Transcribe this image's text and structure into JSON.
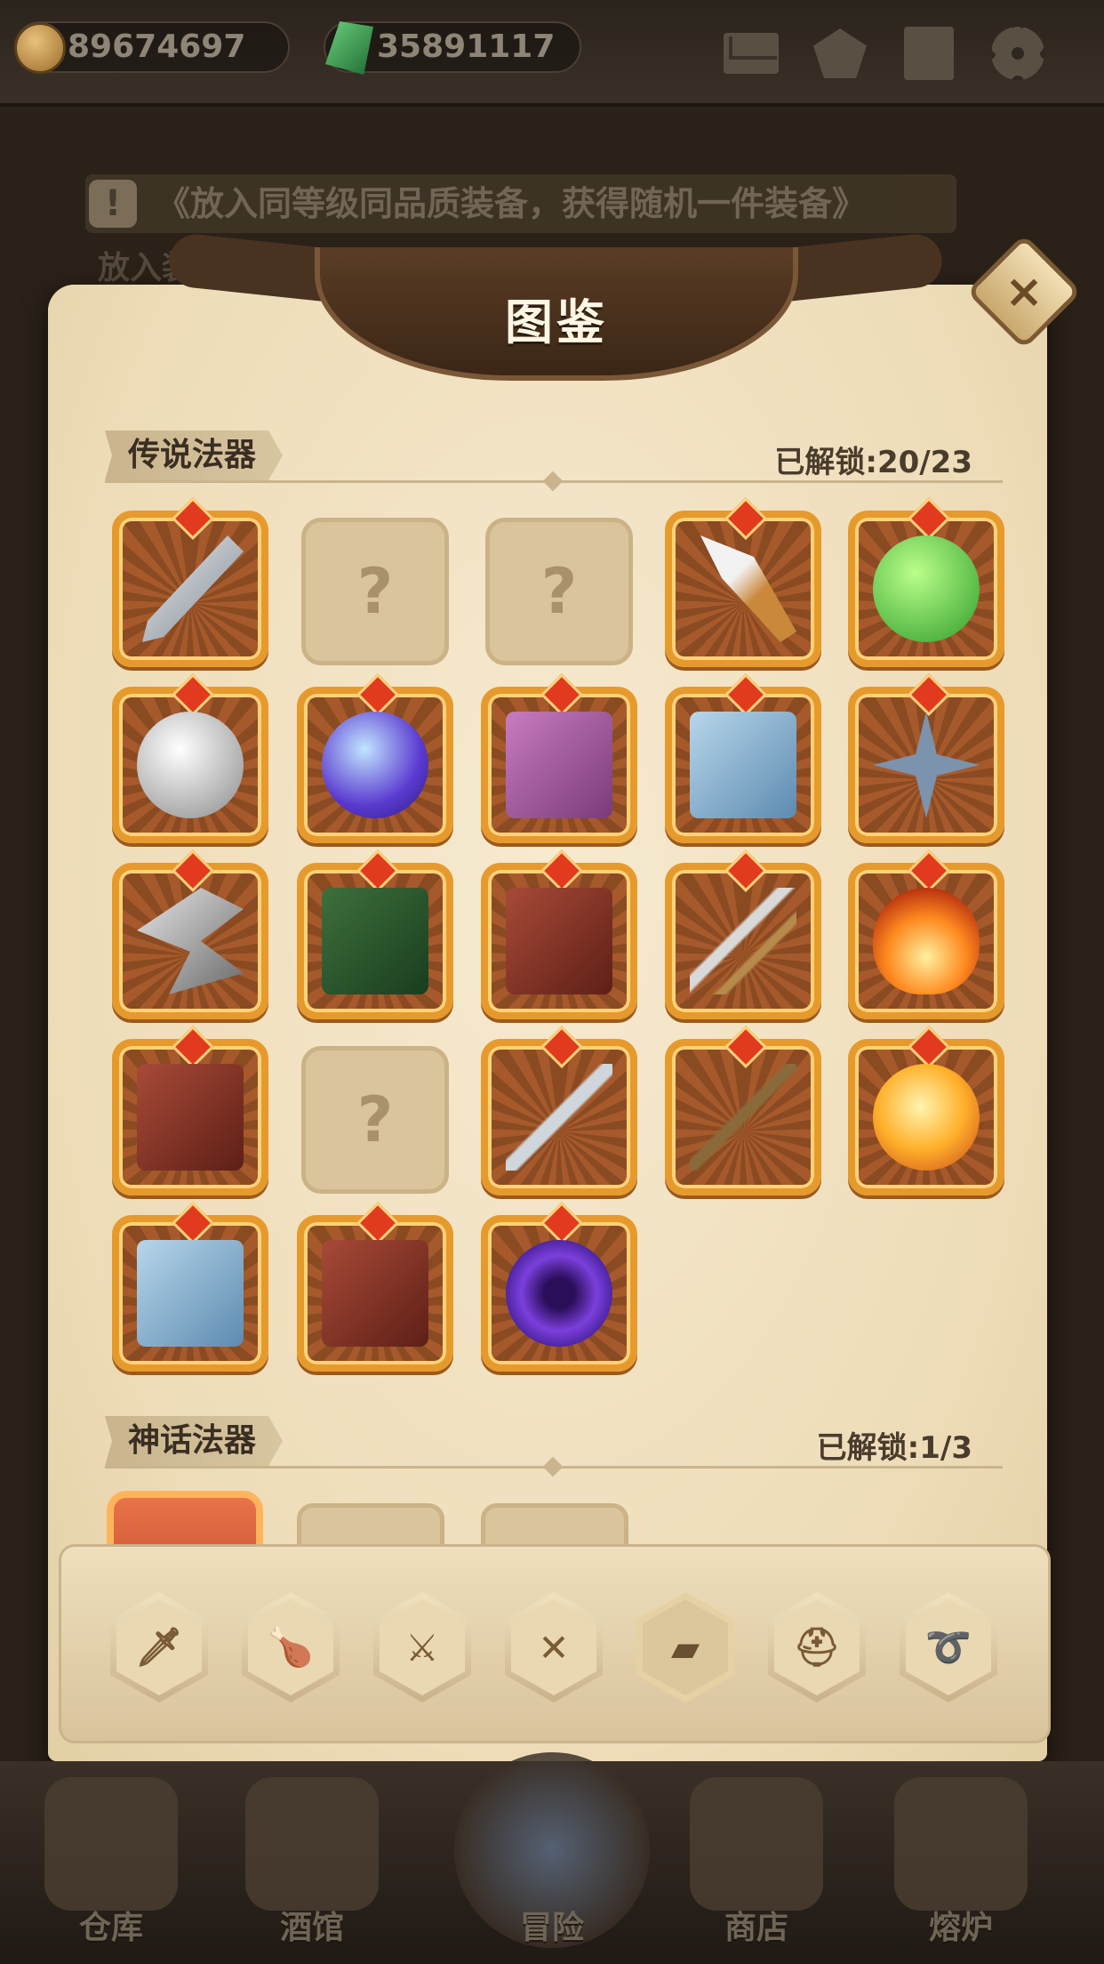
{
  "topbar": {
    "gold": "89674697",
    "gems": "35891117",
    "icons": [
      "coin-icon",
      "gem-icon",
      "mail-icon",
      "star-badge-icon",
      "book-icon",
      "gear-icon"
    ]
  },
  "background": {
    "hint": "《放入同等级同品质装备，获得随机一件装备》",
    "label": "放入装备"
  },
  "dialog": {
    "title": "图鉴",
    "close": "×"
  },
  "legendary": {
    "title": "传说法器",
    "count": "已解锁:20/23",
    "items": [
      {
        "art": "kunai",
        "cls": "blade",
        "locked": false
      },
      {
        "art": "unknown",
        "locked": true
      },
      {
        "art": "unknown",
        "locked": true
      },
      {
        "art": "knife",
        "cls": "knife",
        "locked": false
      },
      {
        "art": "green-slime",
        "cls": "slime",
        "locked": false
      },
      {
        "art": "silver-orb",
        "cls": "silverorb",
        "locked": false
      },
      {
        "art": "purple-planet",
        "cls": "planet",
        "locked": false
      },
      {
        "art": "pink-book",
        "cls": "pinkbook",
        "locked": false
      },
      {
        "art": "blue-book",
        "cls": "bluebook",
        "locked": false
      },
      {
        "art": "shuriken",
        "cls": "shuriken",
        "locked": false
      },
      {
        "art": "hook-blade",
        "cls": "hook",
        "locked": false
      },
      {
        "art": "green-book",
        "cls": "greenbook",
        "locked": false
      },
      {
        "art": "red-book",
        "cls": "redbook",
        "locked": false
      },
      {
        "art": "arrows",
        "cls": "arrows",
        "locked": false
      },
      {
        "art": "fireball",
        "cls": "fire",
        "locked": false
      },
      {
        "art": "red-book",
        "cls": "redbook",
        "locked": false
      },
      {
        "art": "unknown",
        "locked": true
      },
      {
        "art": "dagger",
        "cls": "dagger",
        "locked": false
      },
      {
        "art": "spears",
        "cls": "spear",
        "locked": false
      },
      {
        "art": "sun-orb",
        "cls": "sunorb",
        "locked": false
      },
      {
        "art": "blue-book",
        "cls": "bluebook",
        "locked": false
      },
      {
        "art": "red-book",
        "cls": "redbook",
        "locked": false
      },
      {
        "art": "void-orb",
        "cls": "voidorb",
        "locked": false
      }
    ],
    "locked_mark": "?"
  },
  "mythic": {
    "title": "神话法器",
    "count": "已解锁:1/3"
  },
  "categories": [
    {
      "name": "weapon-tab",
      "icon": "sword-icon",
      "glyph": "🗡",
      "active": false
    },
    {
      "name": "meat-tab",
      "icon": "drumstick-icon",
      "glyph": "🍗",
      "active": false
    },
    {
      "name": "dagger-tab",
      "icon": "blade-icon",
      "glyph": "⚔",
      "active": false
    },
    {
      "name": "crossed-tab",
      "icon": "crossed-icon",
      "glyph": "✕",
      "active": false
    },
    {
      "name": "book-tab",
      "icon": "book-icon",
      "glyph": "▰",
      "active": true
    },
    {
      "name": "helmet-tab",
      "icon": "helmet-icon",
      "glyph": "⛑",
      "active": false
    },
    {
      "name": "necklace-tab",
      "icon": "necklace-icon",
      "glyph": "➰",
      "active": false
    }
  ],
  "nav": [
    {
      "label": "仓库",
      "icon": "warehouse-icon"
    },
    {
      "label": "酒馆",
      "icon": "tavern-icon"
    },
    {
      "label": "冒险",
      "icon": "adventure-icon"
    },
    {
      "label": "商店",
      "icon": "shop-icon"
    },
    {
      "label": "熔炉",
      "icon": "furnace-icon"
    }
  ]
}
